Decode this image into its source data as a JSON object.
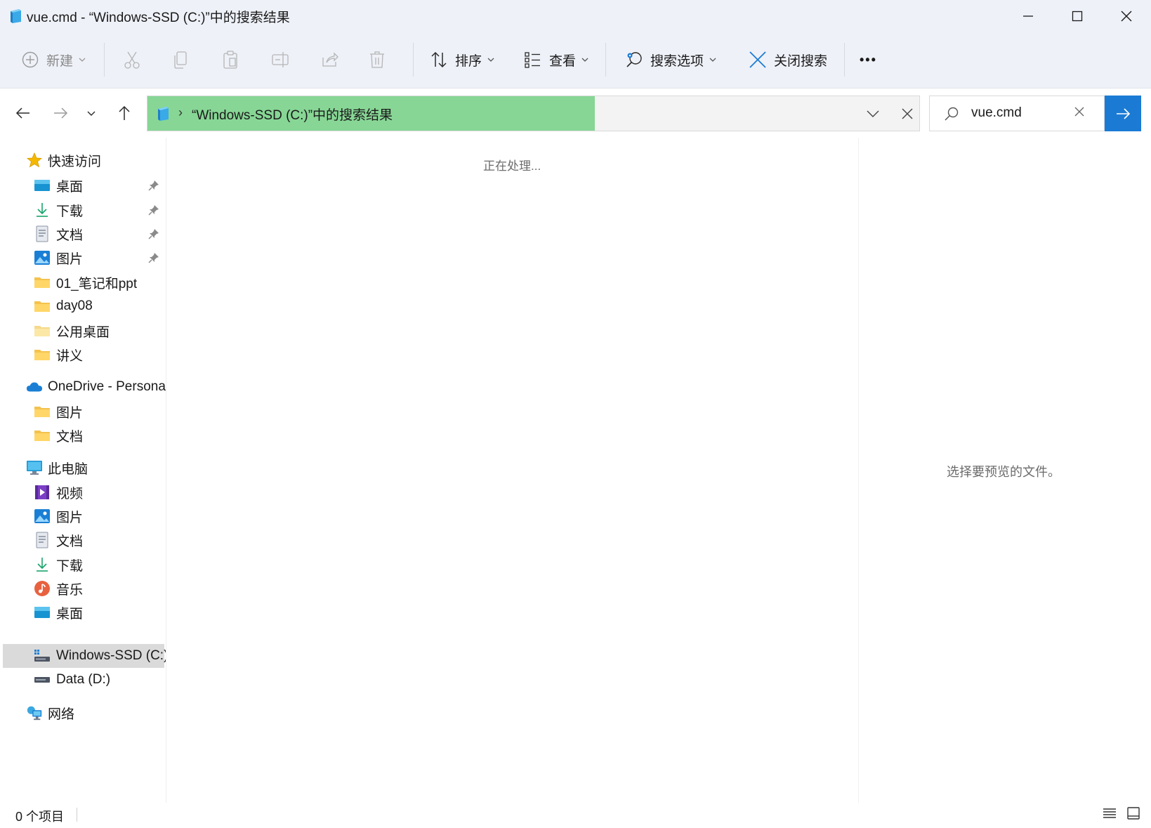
{
  "window": {
    "title": "vue.cmd - “Windows-SSD (C:)”中的搜索结果"
  },
  "toolbar": {
    "new_label": "新建",
    "sort_label": "排序",
    "view_label": "查看",
    "search_options_label": "搜索选项",
    "close_search_label": "关闭搜索",
    "more_label": "•••"
  },
  "address": {
    "separator": "›",
    "path": "“Windows-SSD (C:)”中的搜索结果"
  },
  "search": {
    "value": "vue.cmd"
  },
  "sidebar": {
    "quick_access": "快速访问",
    "quick_items": [
      "桌面",
      "下载",
      "文档",
      "图片",
      "01_笔记和ppt",
      "day08",
      "公用桌面",
      "讲义"
    ],
    "onedrive": "OneDrive - Persona",
    "onedrive_items": [
      "图片",
      "文档"
    ],
    "this_pc": "此电脑",
    "pc_items": [
      "视频",
      "图片",
      "文档",
      "下载",
      "音乐",
      "桌面",
      "Windows-SSD (C:)",
      "Data (D:)"
    ],
    "network": "网络"
  },
  "content": {
    "processing": "正在处理..."
  },
  "preview": {
    "message": "选择要预览的文件。"
  },
  "status": {
    "count": "0 个项目"
  },
  "colors": {
    "accent": "#1b7bd4",
    "address_highlight": "#87d695",
    "selected": "#dadada",
    "chrome": "#eef1f8"
  }
}
